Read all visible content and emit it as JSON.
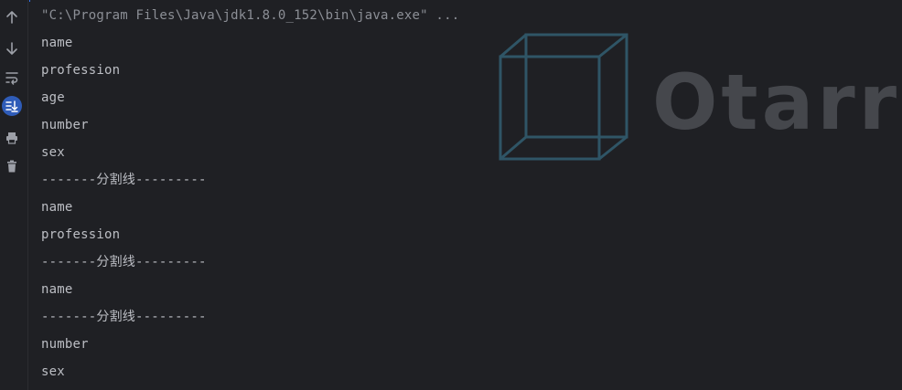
{
  "toolbar": {
    "buttons": [
      {
        "icon": "up-arrow-icon"
      },
      {
        "icon": "down-arrow-icon"
      },
      {
        "icon": "soft-wrap-icon"
      },
      {
        "icon": "scroll-to-end-icon"
      },
      {
        "icon": "print-icon"
      },
      {
        "icon": "trash-icon"
      }
    ]
  },
  "console": {
    "lines": [
      "\"C:\\Program Files\\Java\\jdk1.8.0_152\\bin\\java.exe\" ...",
      "name",
      "profession",
      "age",
      "number",
      "sex",
      "-------分割线---------",
      "name",
      "profession",
      "-------分割线---------",
      "name",
      "-------分割线---------",
      "number",
      "sex"
    ]
  },
  "watermark": {
    "text": "Otarr",
    "color": "#45474c",
    "cube_color": "#2f5566"
  },
  "colors": {
    "background": "#1f2024",
    "text": "#bcbec4",
    "command_text": "#8c8f96",
    "accent": "#3574f0"
  }
}
